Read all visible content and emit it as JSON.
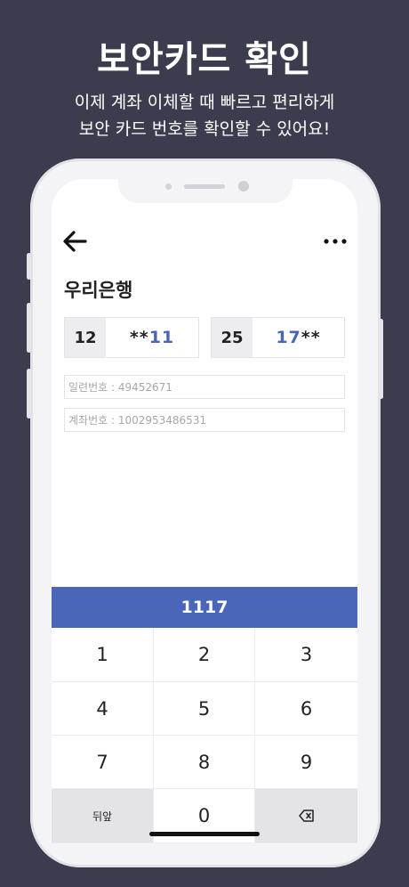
{
  "header": {
    "title": "보안카드 확인",
    "subtitle_line1": "이제 계좌 이체할 때 빠르고 편리하게",
    "subtitle_line2": "보안 카드 번호를 확인할 수 있어요!"
  },
  "app": {
    "bank_name": "우리은행",
    "cards": [
      {
        "index": "12",
        "masked": "**",
        "digits": "11"
      },
      {
        "index": "25",
        "digits": "17",
        "masked": "**"
      }
    ],
    "serial_label": "일련번호 : 49452671",
    "account_label": "계좌번호 : 1002953486531",
    "code": "1117",
    "keys": [
      "1",
      "2",
      "3",
      "4",
      "5",
      "6",
      "7",
      "8",
      "9",
      "뒤앞",
      "0"
    ]
  },
  "colors": {
    "background": "#3b3d4e",
    "accent": "#4a66b8"
  },
  "icons": {
    "back": "back-arrow-icon",
    "more": "more-dots-icon",
    "delete": "backspace-icon"
  }
}
